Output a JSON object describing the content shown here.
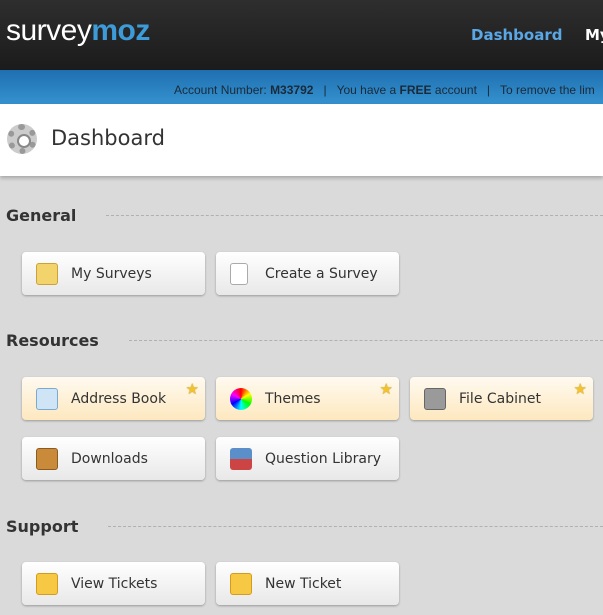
{
  "header": {
    "logo": "surveymoz",
    "logo_plain": "survey",
    "logo_accent": "moz",
    "nav": [
      "Dashboard",
      "My"
    ]
  },
  "account_bar": {
    "label": "Account Number:",
    "number": "M33792",
    "free_prefix": "You have a",
    "free_bold": "FREE",
    "free_suffix": "account",
    "remove": "To remove the lim"
  },
  "page": {
    "title": "Dashboard"
  },
  "sections": {
    "general": {
      "title": "General",
      "items": [
        "My Surveys",
        "Create a Survey"
      ]
    },
    "resources": {
      "title": "Resources",
      "items": [
        "Address Book",
        "Themes",
        "File Cabinet",
        "Downloads",
        "Question Library"
      ]
    },
    "support": {
      "title": "Support",
      "items": [
        "View Tickets",
        "New Ticket"
      ]
    }
  },
  "colors": {
    "accent": "#3d9bd9",
    "favorite_bg": "#fde8bf"
  }
}
